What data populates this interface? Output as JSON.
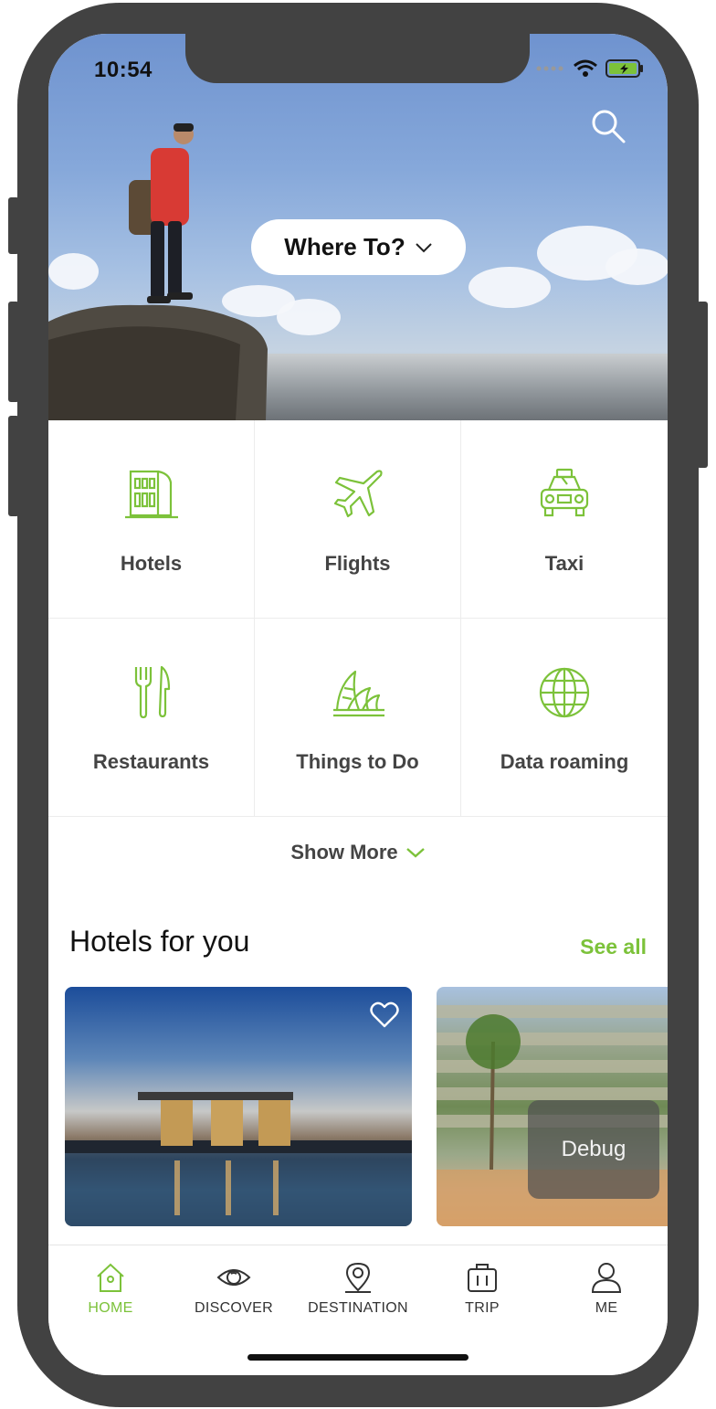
{
  "status": {
    "time": "10:54"
  },
  "hero": {
    "where_label": "Where To?"
  },
  "categories": [
    {
      "label": "Hotels",
      "icon": "hotel-icon"
    },
    {
      "label": "Flights",
      "icon": "airplane-icon"
    },
    {
      "label": "Taxi",
      "icon": "taxi-icon"
    },
    {
      "label": "Restaurants",
      "icon": "fork-knife-icon"
    },
    {
      "label": "Things to Do",
      "icon": "opera-house-icon"
    },
    {
      "label": "Data roaming",
      "icon": "globe-icon"
    }
  ],
  "show_more": {
    "label": "Show More"
  },
  "hotels_section": {
    "title": "Hotels for you",
    "see_all": "See all"
  },
  "debug": {
    "label": "Debug"
  },
  "tabbar": {
    "items": [
      {
        "label": "HOME",
        "icon": "home-icon",
        "active": true
      },
      {
        "label": "DISCOVER",
        "icon": "eye-icon",
        "active": false
      },
      {
        "label": "DESTINATION",
        "icon": "map-pin-icon",
        "active": false
      },
      {
        "label": "TRIP",
        "icon": "suitcase-icon",
        "active": false
      },
      {
        "label": "ME",
        "icon": "user-icon",
        "active": false
      }
    ]
  },
  "colors": {
    "accent": "#7cc23a",
    "frame": "#424242",
    "text": "#444444"
  }
}
